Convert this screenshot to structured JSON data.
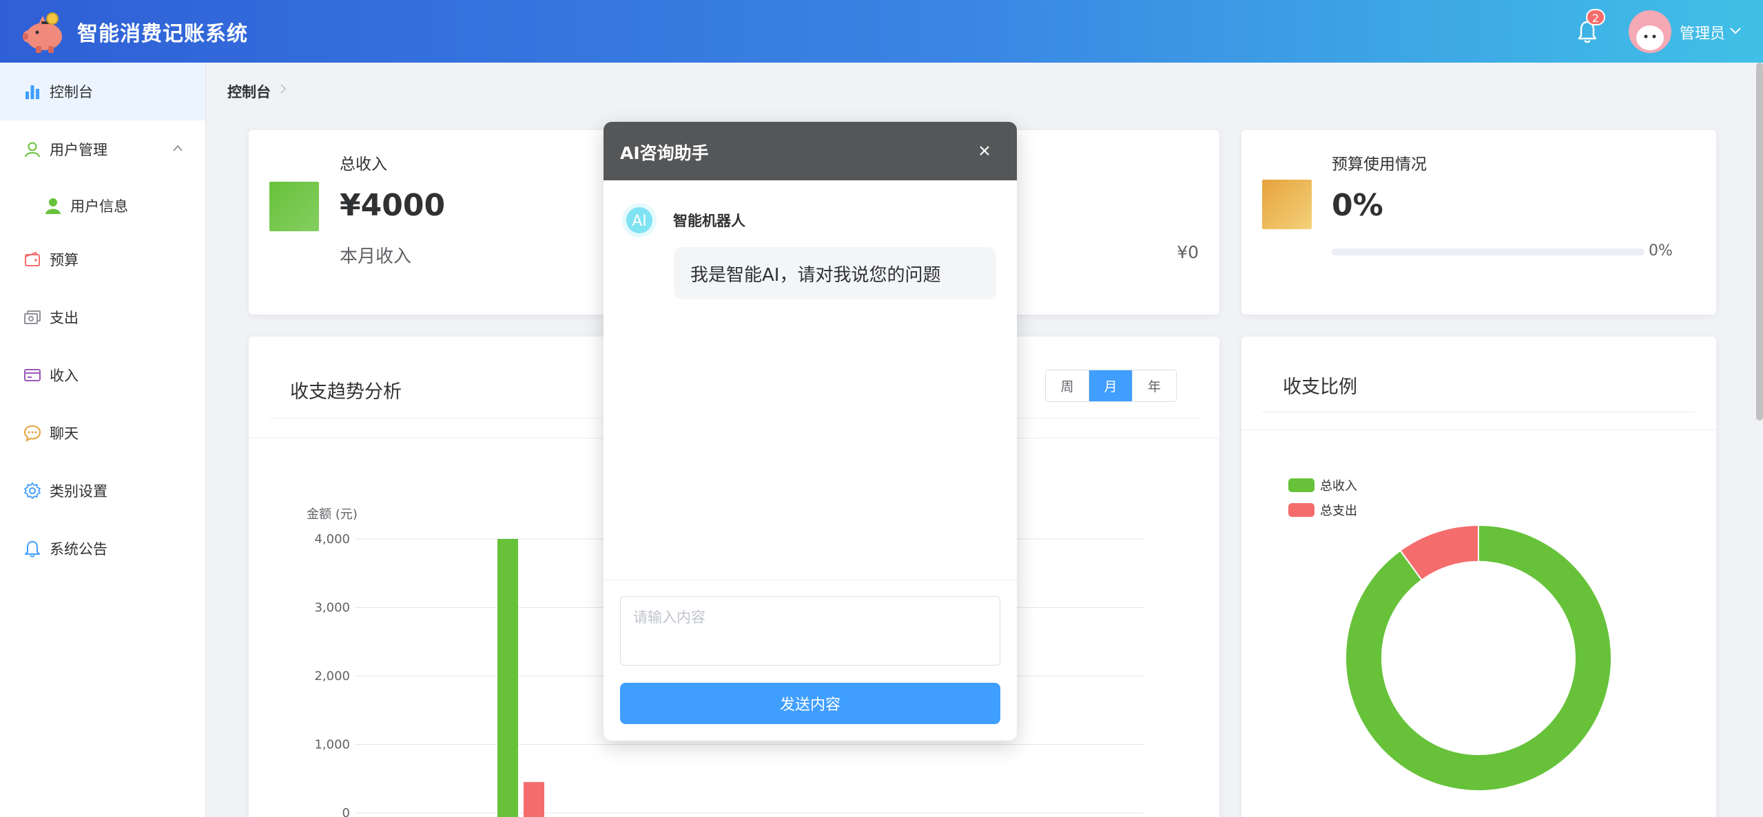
{
  "header": {
    "app_title": "智能消费记账系统",
    "notification_count": "2",
    "user_name": "管理员"
  },
  "sidebar": {
    "items": [
      {
        "label": "控制台",
        "icon": "bar-chart-icon"
      },
      {
        "label": "用户管理",
        "icon": "user-icon"
      },
      {
        "label": "用户信息",
        "icon": "user-filled-icon"
      },
      {
        "label": "预算",
        "icon": "wallet-icon"
      },
      {
        "label": "支出",
        "icon": "money-icon"
      },
      {
        "label": "收入",
        "icon": "credit-card-icon"
      },
      {
        "label": "聊天",
        "icon": "chat-dot-icon"
      },
      {
        "label": "类别设置",
        "icon": "setting-icon"
      },
      {
        "label": "系统公告",
        "icon": "bell-icon"
      }
    ]
  },
  "breadcrumb": {
    "current": "控制台"
  },
  "cards": {
    "income": {
      "label": "总收入",
      "value": "¥4000",
      "sub": "本月收入",
      "color": "#67c23a"
    },
    "expense_partial": {
      "sub_value": "¥0"
    },
    "budget": {
      "label": "预算使用情况",
      "value": "0%",
      "progress_text": "0%",
      "progress": 0,
      "color": "#e6a23c"
    }
  },
  "trend": {
    "title": "收支趋势分析",
    "periods": [
      "周",
      "月",
      "年"
    ],
    "selected_period": "月"
  },
  "ratio": {
    "title": "收支比例",
    "legend": [
      "总收入",
      "总支出"
    ]
  },
  "chart_data": [
    {
      "type": "bar",
      "ylabel": "金额 (元)",
      "ylim": [
        0,
        4000
      ],
      "yticks": [
        "0",
        "1,000",
        "2,000",
        "3,000",
        "4,000"
      ],
      "series": [
        {
          "color": "#67c23a",
          "values": [
            4000
          ]
        },
        {
          "color": "#f56c6c",
          "values": [
            450
          ]
        }
      ]
    },
    {
      "type": "pie",
      "labels": [
        "总收入",
        "总支出"
      ],
      "values": [
        90,
        10
      ],
      "colors": [
        "#67c23a",
        "#f56c6c"
      ]
    }
  ],
  "dialog": {
    "title": "AI咨询助手",
    "bot_name": "智能机器人",
    "bot_avatar_text": "AI",
    "message": "我是智能AI，请对我说您的问题",
    "input_placeholder": "请输入内容",
    "send_label": "发送内容"
  }
}
